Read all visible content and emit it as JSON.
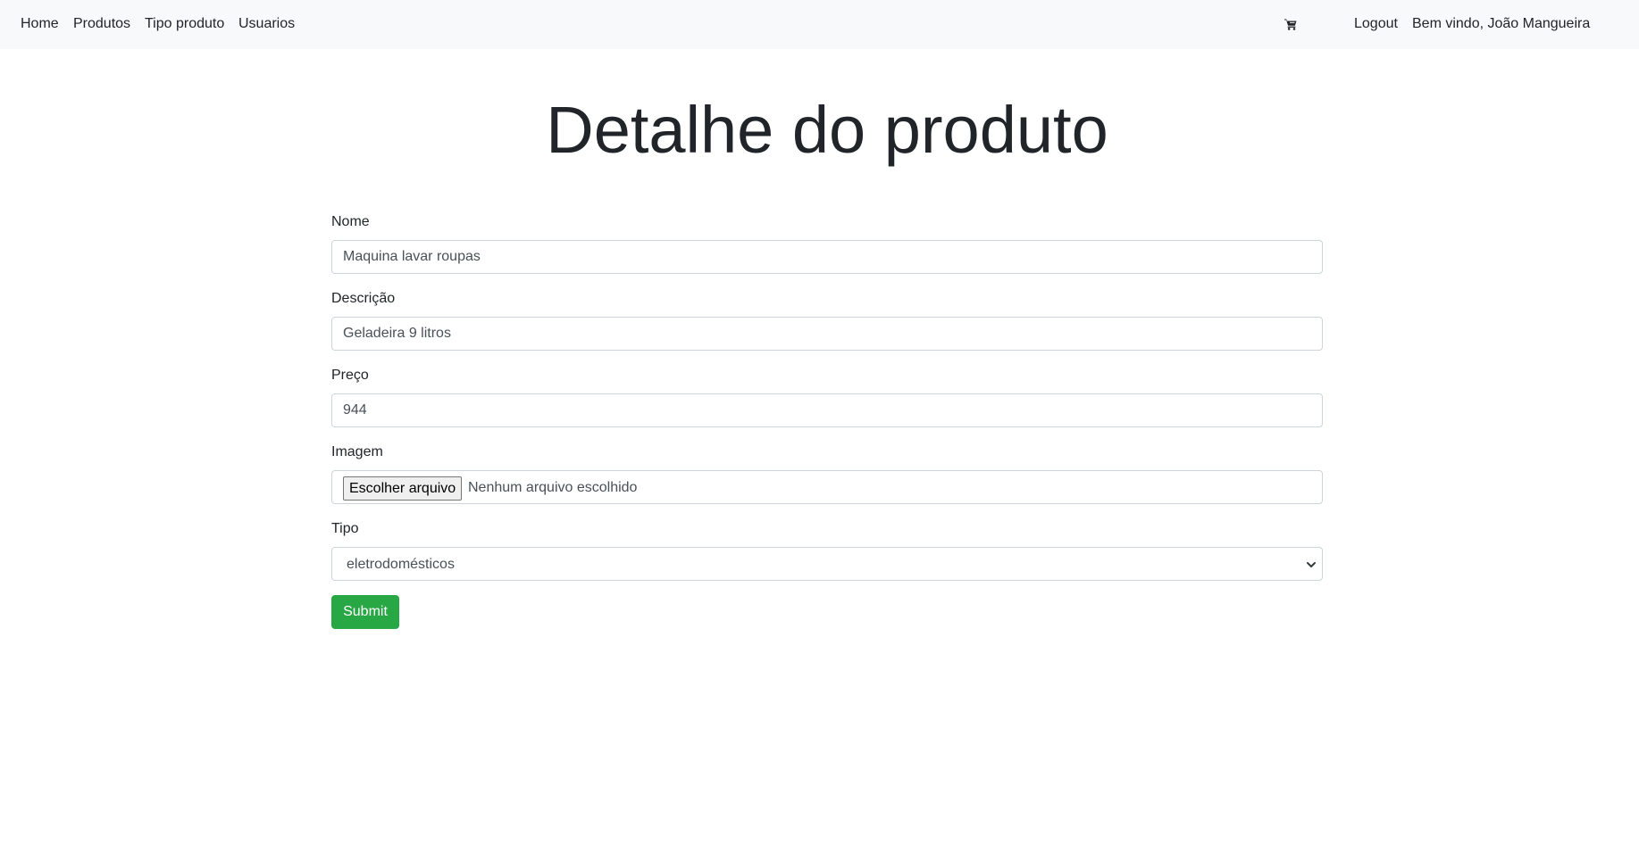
{
  "nav": {
    "links": [
      "Home",
      "Produtos",
      "Tipo produto",
      "Usuarios"
    ],
    "cart_icon": "shopping-cart-icon",
    "logout_label": "Logout",
    "welcome_text": "Bem vindo, João Mangueira",
    "background": "#f8f9fa"
  },
  "page": {
    "title": "Detalhe do produto"
  },
  "form": {
    "nome": {
      "label": "Nome",
      "value": "Maquina lavar roupas"
    },
    "descricao": {
      "label": "Descrição",
      "value": "Geladeira 9 litros"
    },
    "preco": {
      "label": "Preço",
      "value": "944"
    },
    "imagem": {
      "label": "Imagem",
      "button_label": "Escolher arquivo",
      "status": "Nenhum arquivo escolhido"
    },
    "tipo": {
      "label": "Tipo",
      "selected": "eletrodomésticos"
    },
    "submit_label": "Submit",
    "submit_color": "#28a745"
  }
}
